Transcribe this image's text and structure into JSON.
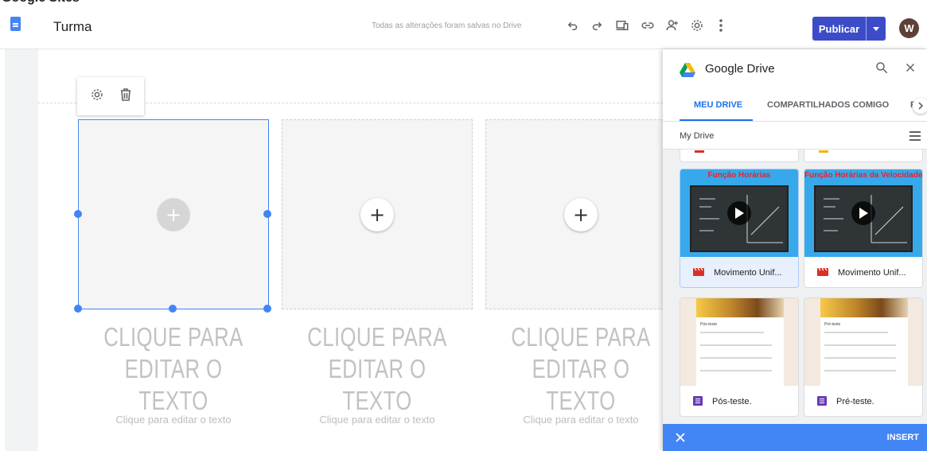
{
  "topbar": {
    "doc_title": "Turma",
    "save_status": "Todas as alterações foram salvas no Drive",
    "publish_label": "Publicar",
    "avatar_letter": "W"
  },
  "canvas": {
    "placeholders": [
      {
        "heading": "CLIQUE PARA EDITAR O TEXTO",
        "subtext": "Clique para editar o texto",
        "selected": true
      },
      {
        "heading": "CLIQUE PARA EDITAR O TEXTO",
        "subtext": "Clique para editar o texto",
        "selected": false
      },
      {
        "heading": "CLIQUE PARA EDITAR O TEXTO",
        "subtext": "Clique para editar o texto",
        "selected": false
      }
    ]
  },
  "drive": {
    "title": "Google Drive",
    "tabs": [
      "MEU DRIVE",
      "COMPARTILHADOS COMIGO",
      "R"
    ],
    "active_tab": "MEU DRIVE",
    "breadcrumb": "My Drive",
    "files": [
      {
        "name": "Movimento Unif...",
        "type": "video",
        "thumb_title": "Função Horárias",
        "selected": true
      },
      {
        "name": "Movimento Unif...",
        "type": "video",
        "thumb_title": "Função Horárias da Velocidade",
        "selected": false
      },
      {
        "name": "Pós-teste.",
        "type": "form",
        "thumb_title": "Pós-teste",
        "selected": false
      },
      {
        "name": "Pré-teste.",
        "type": "form",
        "thumb_title": "Pré-teste",
        "selected": false
      }
    ],
    "insert_label": "INSERT"
  },
  "colors": {
    "accent": "#4285f4",
    "publish": "#3c4cc9",
    "video_icon": "#d93025",
    "form_icon": "#673ab7"
  }
}
